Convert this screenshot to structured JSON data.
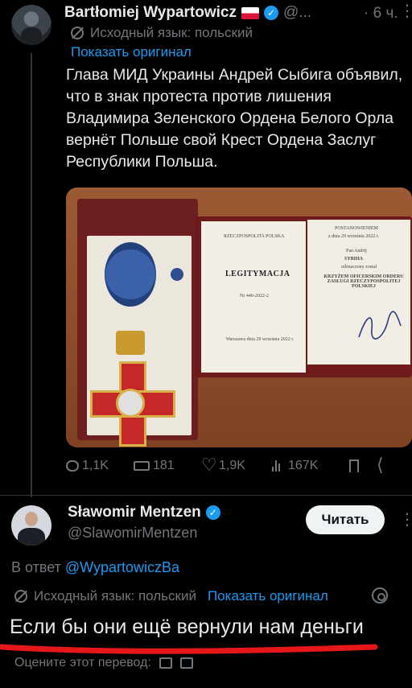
{
  "tweet1": {
    "author_name": "Bartłomiej Wypartowicz",
    "handle": "@...",
    "time": "· 6 ч.",
    "more": "⋮",
    "translation_note": "Исходный язык: польский",
    "show_original": "Показать оригинал",
    "body": "Глава МИД Украины Андрей Сыбига объявил, что в знак протеста против лишения Владимира Зеленского Ордена Белого Орла вернёт Польше свой Крест Ордена Заслуг Республики Польша.",
    "photo": {
      "doc_header_left": "RZECZPOSPOLITA POLSKA",
      "doc_title": "LEGITYMACJA",
      "doc_number": "Nr 446-2022-2",
      "doc_place_date": "Warszawa dnia 29 września 2022 r.",
      "doc_header_right": "POSTANOWIENIEM",
      "doc_date_right": "z dnia 29 września 2022 r.",
      "doc_recipient_prefix": "Pan Andrij",
      "doc_recipient": "SYBIHA",
      "doc_awarded": "odznaczony został",
      "doc_award": "KRZYŻEM OFICERSKIM ORDERU ZASŁUGI RZECZYPOSPOLITEJ POLSKIEJ"
    },
    "actions": {
      "replies": "1,1K",
      "reposts": "181",
      "likes": "1,9K",
      "views": "167K"
    }
  },
  "tweet2": {
    "author_name": "Sławomir Mentzen",
    "handle": "@SlawomirMentzen",
    "follow_label": "Читать",
    "more": "⋮",
    "reply_prefix": "В ответ",
    "reply_handle": "@WypartowiczBa",
    "translation_note": "Исходный язык: польский",
    "show_original": "Показать оригинал",
    "body": "Если бы они ещё вернули нам деньги",
    "rate_label": "Оцените этот перевод:"
  },
  "colors": {
    "background": "#000000",
    "text": "#e7e9ea",
    "muted": "#71767b",
    "link": "#1d9bf0",
    "underline": "#e5171b"
  }
}
